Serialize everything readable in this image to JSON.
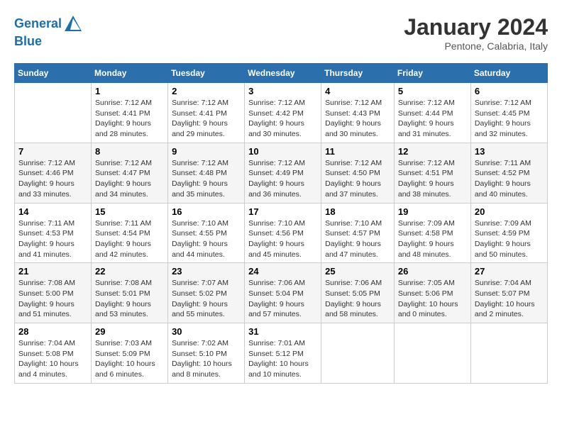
{
  "header": {
    "logo_line1": "General",
    "logo_line2": "Blue",
    "title": "January 2024",
    "location": "Pentone, Calabria, Italy"
  },
  "columns": [
    "Sunday",
    "Monday",
    "Tuesday",
    "Wednesday",
    "Thursday",
    "Friday",
    "Saturday"
  ],
  "weeks": [
    [
      {
        "day": "",
        "info": ""
      },
      {
        "day": "1",
        "info": "Sunrise: 7:12 AM\nSunset: 4:41 PM\nDaylight: 9 hours\nand 28 minutes."
      },
      {
        "day": "2",
        "info": "Sunrise: 7:12 AM\nSunset: 4:41 PM\nDaylight: 9 hours\nand 29 minutes."
      },
      {
        "day": "3",
        "info": "Sunrise: 7:12 AM\nSunset: 4:42 PM\nDaylight: 9 hours\nand 30 minutes."
      },
      {
        "day": "4",
        "info": "Sunrise: 7:12 AM\nSunset: 4:43 PM\nDaylight: 9 hours\nand 30 minutes."
      },
      {
        "day": "5",
        "info": "Sunrise: 7:12 AM\nSunset: 4:44 PM\nDaylight: 9 hours\nand 31 minutes."
      },
      {
        "day": "6",
        "info": "Sunrise: 7:12 AM\nSunset: 4:45 PM\nDaylight: 9 hours\nand 32 minutes."
      }
    ],
    [
      {
        "day": "7",
        "info": "Sunrise: 7:12 AM\nSunset: 4:46 PM\nDaylight: 9 hours\nand 33 minutes."
      },
      {
        "day": "8",
        "info": "Sunrise: 7:12 AM\nSunset: 4:47 PM\nDaylight: 9 hours\nand 34 minutes."
      },
      {
        "day": "9",
        "info": "Sunrise: 7:12 AM\nSunset: 4:48 PM\nDaylight: 9 hours\nand 35 minutes."
      },
      {
        "day": "10",
        "info": "Sunrise: 7:12 AM\nSunset: 4:49 PM\nDaylight: 9 hours\nand 36 minutes."
      },
      {
        "day": "11",
        "info": "Sunrise: 7:12 AM\nSunset: 4:50 PM\nDaylight: 9 hours\nand 37 minutes."
      },
      {
        "day": "12",
        "info": "Sunrise: 7:12 AM\nSunset: 4:51 PM\nDaylight: 9 hours\nand 38 minutes."
      },
      {
        "day": "13",
        "info": "Sunrise: 7:11 AM\nSunset: 4:52 PM\nDaylight: 9 hours\nand 40 minutes."
      }
    ],
    [
      {
        "day": "14",
        "info": "Sunrise: 7:11 AM\nSunset: 4:53 PM\nDaylight: 9 hours\nand 41 minutes."
      },
      {
        "day": "15",
        "info": "Sunrise: 7:11 AM\nSunset: 4:54 PM\nDaylight: 9 hours\nand 42 minutes."
      },
      {
        "day": "16",
        "info": "Sunrise: 7:10 AM\nSunset: 4:55 PM\nDaylight: 9 hours\nand 44 minutes."
      },
      {
        "day": "17",
        "info": "Sunrise: 7:10 AM\nSunset: 4:56 PM\nDaylight: 9 hours\nand 45 minutes."
      },
      {
        "day": "18",
        "info": "Sunrise: 7:10 AM\nSunset: 4:57 PM\nDaylight: 9 hours\nand 47 minutes."
      },
      {
        "day": "19",
        "info": "Sunrise: 7:09 AM\nSunset: 4:58 PM\nDaylight: 9 hours\nand 48 minutes."
      },
      {
        "day": "20",
        "info": "Sunrise: 7:09 AM\nSunset: 4:59 PM\nDaylight: 9 hours\nand 50 minutes."
      }
    ],
    [
      {
        "day": "21",
        "info": "Sunrise: 7:08 AM\nSunset: 5:00 PM\nDaylight: 9 hours\nand 51 minutes."
      },
      {
        "day": "22",
        "info": "Sunrise: 7:08 AM\nSunset: 5:01 PM\nDaylight: 9 hours\nand 53 minutes."
      },
      {
        "day": "23",
        "info": "Sunrise: 7:07 AM\nSunset: 5:02 PM\nDaylight: 9 hours\nand 55 minutes."
      },
      {
        "day": "24",
        "info": "Sunrise: 7:06 AM\nSunset: 5:04 PM\nDaylight: 9 hours\nand 57 minutes."
      },
      {
        "day": "25",
        "info": "Sunrise: 7:06 AM\nSunset: 5:05 PM\nDaylight: 9 hours\nand 58 minutes."
      },
      {
        "day": "26",
        "info": "Sunrise: 7:05 AM\nSunset: 5:06 PM\nDaylight: 10 hours\nand 0 minutes."
      },
      {
        "day": "27",
        "info": "Sunrise: 7:04 AM\nSunset: 5:07 PM\nDaylight: 10 hours\nand 2 minutes."
      }
    ],
    [
      {
        "day": "28",
        "info": "Sunrise: 7:04 AM\nSunset: 5:08 PM\nDaylight: 10 hours\nand 4 minutes."
      },
      {
        "day": "29",
        "info": "Sunrise: 7:03 AM\nSunset: 5:09 PM\nDaylight: 10 hours\nand 6 minutes."
      },
      {
        "day": "30",
        "info": "Sunrise: 7:02 AM\nSunset: 5:10 PM\nDaylight: 10 hours\nand 8 minutes."
      },
      {
        "day": "31",
        "info": "Sunrise: 7:01 AM\nSunset: 5:12 PM\nDaylight: 10 hours\nand 10 minutes."
      },
      {
        "day": "",
        "info": ""
      },
      {
        "day": "",
        "info": ""
      },
      {
        "day": "",
        "info": ""
      }
    ]
  ]
}
